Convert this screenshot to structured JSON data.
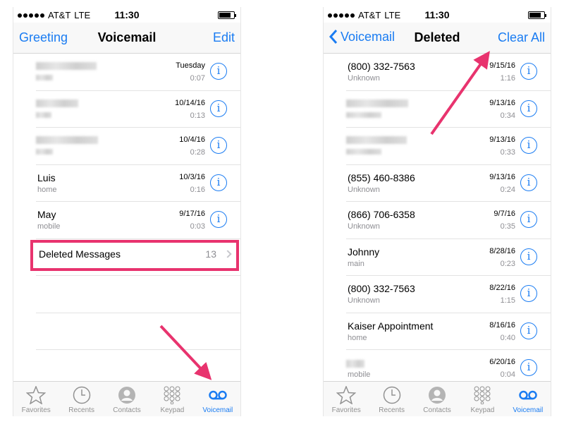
{
  "colors": {
    "accent": "#1a7cf2",
    "highlight": "#e8336e",
    "secondary_text": "#8e8e93"
  },
  "status_bar": {
    "carrier": "AT&T",
    "network": "LTE",
    "time": "11:30"
  },
  "left": {
    "nav": {
      "left": "Greeting",
      "title": "Voicemail",
      "right": "Edit"
    },
    "rows": [
      {
        "name": "",
        "sub": "",
        "date": "Tuesday",
        "duration": "0:07"
      },
      {
        "name": "",
        "sub": "",
        "date": "10/14/16",
        "duration": "0:13"
      },
      {
        "name": "",
        "sub": "",
        "date": "10/4/16",
        "duration": "0:28"
      },
      {
        "name": "Luis",
        "sub": "home",
        "date": "10/3/16",
        "duration": "0:16"
      },
      {
        "name": "May",
        "sub": "mobile",
        "date": "9/17/16",
        "duration": "0:03"
      }
    ],
    "deleted": {
      "label": "Deleted Messages",
      "count": "13"
    }
  },
  "right": {
    "nav": {
      "back": "Voicemail",
      "title": "Deleted",
      "right": "Clear All"
    },
    "rows": [
      {
        "name": "(800) 332-7563",
        "sub": "Unknown",
        "date": "9/15/16",
        "duration": "1:16"
      },
      {
        "name": "",
        "sub": "",
        "date": "9/13/16",
        "duration": "0:34"
      },
      {
        "name": "",
        "sub": "",
        "date": "9/13/16",
        "duration": "0:33"
      },
      {
        "name": "(855) 460-8386",
        "sub": "Unknown",
        "date": "9/13/16",
        "duration": "0:24"
      },
      {
        "name": "(866) 706-6358",
        "sub": "Unknown",
        "date": "9/7/16",
        "duration": "0:35"
      },
      {
        "name": "Johnny",
        "sub": "main",
        "date": "8/28/16",
        "duration": "0:23"
      },
      {
        "name": "(800) 332-7563",
        "sub": "Unknown",
        "date": "8/22/16",
        "duration": "1:15"
      },
      {
        "name": "Kaiser Appointment",
        "sub": "home",
        "date": "8/16/16",
        "duration": "0:40"
      },
      {
        "name": "",
        "sub": "mobile",
        "date": "6/20/16",
        "duration": "0:04"
      }
    ]
  },
  "tabs": [
    {
      "label": "Favorites",
      "icon": "star-icon"
    },
    {
      "label": "Recents",
      "icon": "clock-icon"
    },
    {
      "label": "Contacts",
      "icon": "person-icon"
    },
    {
      "label": "Keypad",
      "icon": "keypad-icon"
    },
    {
      "label": "Voicemail",
      "icon": "voicemail-icon"
    }
  ],
  "info_glyph": "i"
}
